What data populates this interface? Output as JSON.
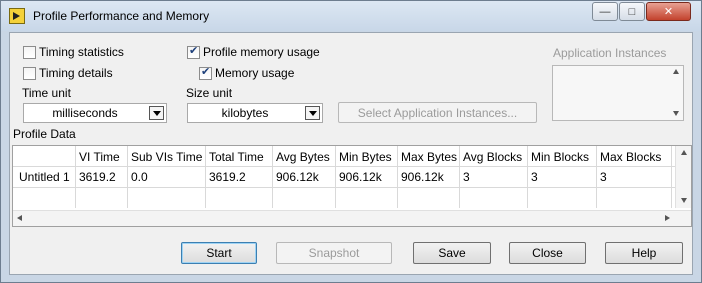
{
  "window": {
    "title": "Profile Performance and Memory",
    "controls": {
      "minimize": "—",
      "maximize": "□",
      "close": "✕"
    }
  },
  "options": {
    "timing_statistics": {
      "label": "Timing statistics",
      "checked": false
    },
    "timing_details": {
      "label": "Timing details",
      "checked": false
    },
    "profile_memory_usage": {
      "label": "Profile memory usage",
      "checked": true
    },
    "memory_usage": {
      "label": "Memory usage",
      "checked": true
    }
  },
  "time_unit": {
    "label": "Time unit",
    "value": "milliseconds"
  },
  "size_unit": {
    "label": "Size unit",
    "value": "kilobytes"
  },
  "select_instances_button": "Select Application Instances...",
  "app_instances": {
    "label": "Application Instances"
  },
  "profile_data": {
    "label": "Profile Data",
    "columns": [
      "",
      "VI Time",
      "Sub VIs Time",
      "Total Time",
      "Avg Bytes",
      "Min Bytes",
      "Max Bytes",
      "Avg Blocks",
      "Min Blocks",
      "Max Blocks"
    ],
    "rows": [
      [
        "Untitled 1",
        "3619.2",
        "0.0",
        "3619.2",
        "906.12k",
        "906.12k",
        "906.12k",
        "3",
        "3",
        "3"
      ]
    ]
  },
  "buttons": {
    "start": "Start",
    "snapshot": "Snapshot",
    "save": "Save",
    "close": "Close",
    "help": "Help"
  },
  "colors": {
    "frame": "#c9d6e5",
    "client_bg": "#f0f0f0",
    "close_button": "#c3422d",
    "check_mark": "#1d3f7a"
  }
}
